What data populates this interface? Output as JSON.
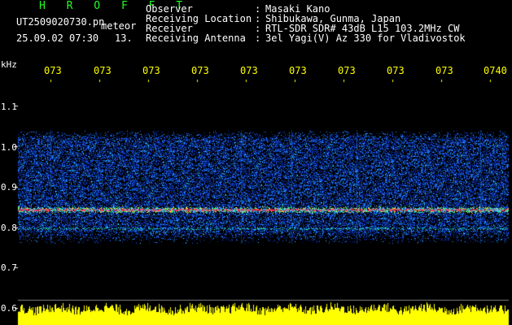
{
  "header": {
    "title": "H R O F F T",
    "filename": "UT2509020730.pn",
    "meteor_label": "meteor",
    "datetime": "25.09.02 07:30",
    "count": "13.",
    "fields": [
      {
        "label": "Observer",
        "sep": ":",
        "value": "Masaki Kano"
      },
      {
        "label": "Receiving Location",
        "sep": ":",
        "value": "Shibukawa, Gunma, Japan"
      },
      {
        "label": "Receiver",
        "sep": ":",
        "value": "RTL-SDR SDR# 43dB L15 103.2MHz CW"
      },
      {
        "label": "Receiving Antenna",
        "sep": ":",
        "value": "3el Yagi(V) Az 330 for Vladivostok"
      }
    ]
  },
  "axis": {
    "unit": "kHz",
    "y_ticks": [
      "1.1",
      "1.0",
      "0.9",
      "0.8",
      "0.7",
      "0.6"
    ],
    "x_ticks": [
      "073",
      "073",
      "073",
      "073",
      "073",
      "073",
      "073",
      "073",
      "073",
      "0740"
    ]
  },
  "colors": {
    "background": "#000000",
    "text": "#ffffff",
    "title": "#22ff22",
    "time_ticks": "#ffff00",
    "echo_band": "#ff3355",
    "noise": "#1e64ff",
    "level_bar": "#ffff00"
  }
}
